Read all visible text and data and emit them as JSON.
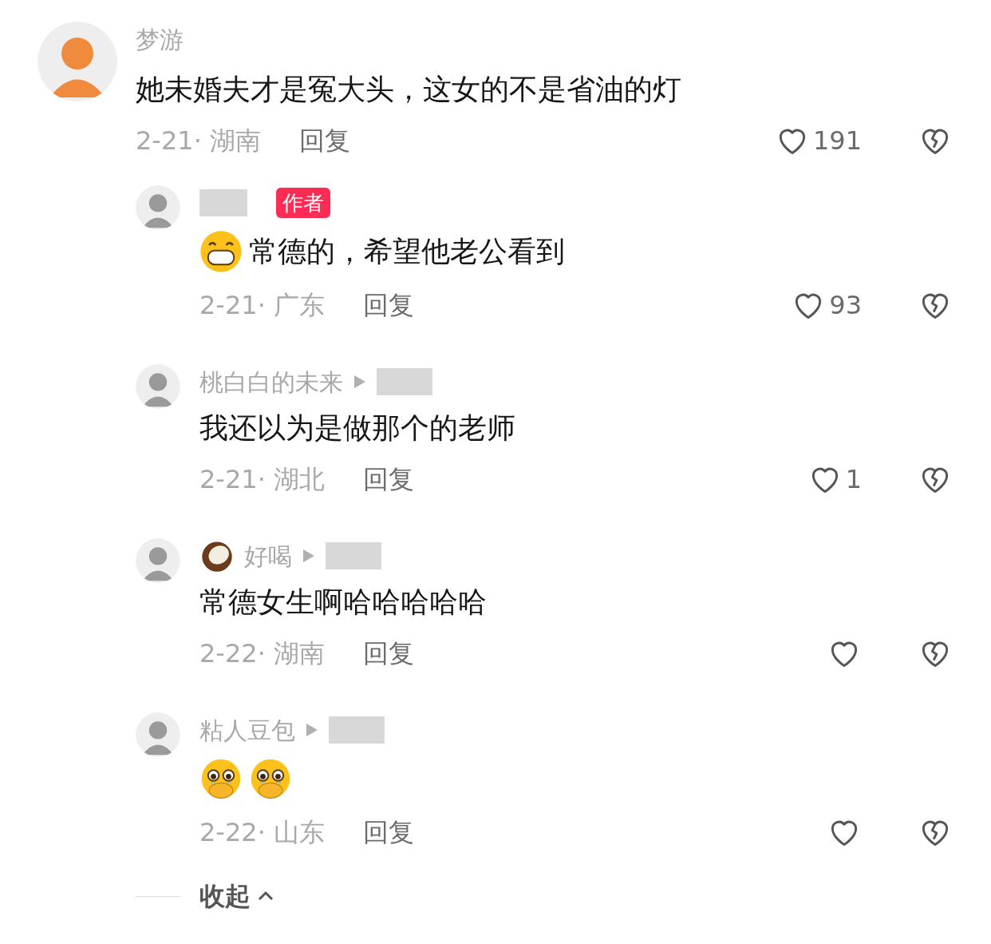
{
  "comment": {
    "name": "梦游",
    "content": [
      {
        "kind": "text",
        "text": "她未婚夫才是冤大头，这女的不是省油的灯"
      }
    ],
    "meta": "2-21· 湖南",
    "reply_label": "回复",
    "likes": "191",
    "liked": false
  },
  "replies": [
    {
      "name_redacted": true,
      "author_badge": "作者",
      "content": [
        {
          "kind": "grin"
        },
        {
          "kind": "text",
          "text": "常德的，希望他老公看到"
        }
      ],
      "meta": "2-21· 广东",
      "reply_label": "回复",
      "likes": "93",
      "liked": false
    },
    {
      "name": "桃白白的未来",
      "reply_to_redacted": true,
      "content": [
        {
          "kind": "text",
          "text": "我还以为是做那个的老师"
        }
      ],
      "meta": "2-21· 湖北",
      "reply_label": "回复",
      "likes": "1",
      "liked": false
    },
    {
      "name_icon": {
        "kind": "coconut"
      },
      "name": "好喝",
      "reply_to_redacted": true,
      "content": [
        {
          "kind": "text",
          "text": "常德女生啊哈哈哈哈哈"
        }
      ],
      "meta": "2-22· 湖南",
      "reply_label": "回复",
      "liked": false
    },
    {
      "name": "粘人豆包",
      "reply_to_redacted": true,
      "content": [
        {
          "kind": "crying"
        },
        {
          "kind": "crying"
        }
      ],
      "meta": "2-22· 山东",
      "reply_label": "回复",
      "liked": false
    }
  ],
  "collapse": {
    "label": "收起"
  }
}
